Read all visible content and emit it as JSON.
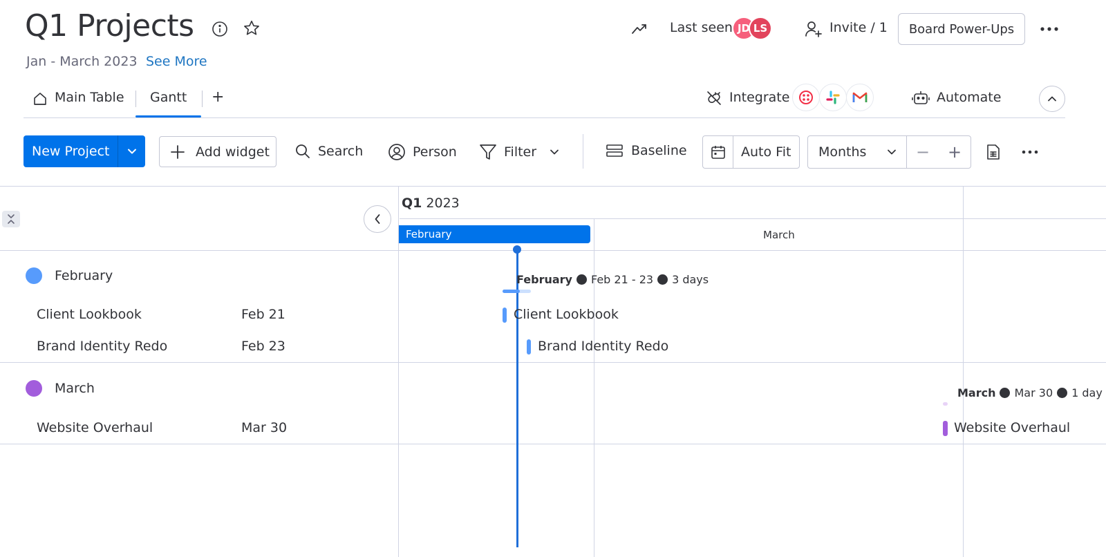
{
  "board": {
    "title": "Q1 Projects",
    "subtitle": "Jan - March 2023",
    "see_more": "See More"
  },
  "header": {
    "last_seen_label": "Last seen",
    "avatars": [
      {
        "initials": "JD",
        "color": "#f65f7c"
      },
      {
        "initials": "LS",
        "color": "#e2445c"
      }
    ],
    "invite_label": "Invite / 1",
    "power_ups_label": "Board Power-Ups"
  },
  "tabs": {
    "items": [
      {
        "label": "Main Table",
        "active": false
      },
      {
        "label": "Gantt",
        "active": true
      }
    ],
    "add_label": "+",
    "integrate_label": "Integrate",
    "integrations": [
      "twilio-icon",
      "slack-icon",
      "gmail-icon"
    ],
    "automate_label": "Automate"
  },
  "toolbar": {
    "new_project_label": "New Project",
    "add_widget_label": "Add widget",
    "search_label": "Search",
    "person_label": "Person",
    "filter_label": "Filter",
    "baseline_label": "Baseline",
    "auto_fit_label": "Auto Fit",
    "scale_label": "Months",
    "zoom_out": "−",
    "zoom_in": "+"
  },
  "gantt": {
    "quarter_bold": "Q1",
    "quarter_year": "2023",
    "months": [
      {
        "label": "February",
        "active": true
      },
      {
        "label": "March",
        "active": false
      }
    ],
    "groups": [
      {
        "name": "February",
        "color": "#579bfc",
        "summary": {
          "name": "February",
          "range": "Feb 21 - 23",
          "duration": "3 days"
        },
        "items": [
          {
            "name": "Client Lookbook",
            "date": "Feb 21"
          },
          {
            "name": "Brand Identity Redo",
            "date": "Feb 23"
          }
        ]
      },
      {
        "name": "March",
        "color": "#a25ddc",
        "summary": {
          "name": "March",
          "range": "Mar 30",
          "duration": "1 day"
        },
        "items": [
          {
            "name": "Website Overhaul",
            "date": "Mar 30"
          }
        ]
      }
    ]
  },
  "colors": {
    "primary": "#0073ea",
    "today_line": "#1f6fd9",
    "february_group": "#579bfc",
    "march_group": "#a25ddc"
  }
}
